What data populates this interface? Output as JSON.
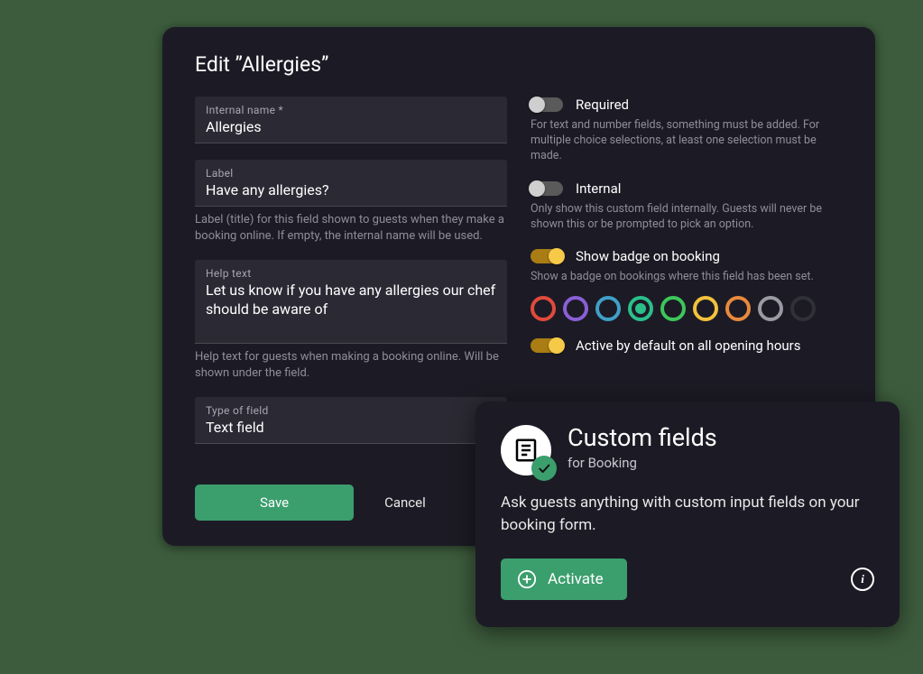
{
  "dialog": {
    "title": "Edit ”Allergies”",
    "internal_name_label": "Internal name *",
    "internal_name_value": "Allergies",
    "label_label": "Label",
    "label_value": "Have any allergies?",
    "label_hint": "Label (title) for this field shown to guests when they make a booking online. If empty, the internal name will be used.",
    "help_text_label": "Help text",
    "help_text_value": "Let us know if you have any allergies our chef should be aware of",
    "help_text_hint": "Help text for guests when making a booking online. Will be shown under the field.",
    "type_label": "Type of field",
    "type_value": "Text field",
    "save_label": "Save",
    "cancel_label": "Cancel"
  },
  "right": {
    "required_label": "Required",
    "required_on": false,
    "required_hint": "For text and number fields, something must be added. For multiple choice selections, at least one selection must be made.",
    "internal_label": "Internal",
    "internal_on": false,
    "internal_hint": "Only show this custom field internally. Guests will never be shown this or be prompted to pick an option.",
    "badge_label": "Show badge on booking",
    "badge_on": true,
    "badge_hint": "Show a badge on bookings where this field has been set.",
    "active_label": "Active by default on all opening hours",
    "active_on": true,
    "colors": [
      "#e24a3b",
      "#8a5fd6",
      "#3fa0c8",
      "#2bbf8a",
      "#3cc75a",
      "#f2c23c",
      "#e8893c",
      "#9a9aa2",
      "#303038"
    ],
    "selected_color_index": 3
  },
  "card": {
    "title": "Custom fields",
    "subtitle": "for Booking",
    "description": "Ask guests anything with custom input fields on your booking form.",
    "activate_label": "Activate"
  }
}
